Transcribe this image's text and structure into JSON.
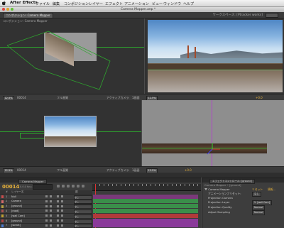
{
  "menubar": {
    "app_name": "After Effects",
    "items": [
      "ファイル",
      "編集",
      "コンポジション",
      "レイヤー",
      "エフェクト",
      "アニメーション",
      "ビュー",
      "ウィンドウ",
      "ヘルプ"
    ]
  },
  "window": {
    "title": "Camera Mapper.aep *"
  },
  "toolbar": {
    "panel_tab": "コンポジション: Camera Mapper",
    "workspace": "ワークスペース: [Ptracker works]"
  },
  "viewers": {
    "zoom": "12.5%",
    "timecode": "00014",
    "quality": "フル画質",
    "view_mode": "1画面",
    "camera": "アクティブカメラ",
    "exposure": "+0.0"
  },
  "timeline": {
    "tabs": [
      "Camera Mapper"
    ],
    "timecode": "00014",
    "fps": "0.0.0 fps (23.976)",
    "header": {
      "num": "#",
      "layer_name": "レイヤー名",
      "parent": "親"
    },
    "layers": [
      {
        "num": "1",
        "name": "Null",
        "color": "#c84b4b",
        "parent": "なし",
        "bar_color": "#7a3a7a"
      },
      {
        "num": "2",
        "name": "Camera",
        "color": "#d46a6a",
        "parent": "なし",
        "bar_color": "#3a8e4a"
      },
      {
        "num": "3",
        "name": "[ground]",
        "color": "#b8a040",
        "parent": "なし",
        "bar_color": "#3a8e4a"
      },
      {
        "num": "4",
        "name": "[road]",
        "color": "#a85050",
        "parent": "なし",
        "bar_color": "#3a8e4a"
      },
      {
        "num": "5",
        "name": "[wall Cam]",
        "color": "#c0a030",
        "parent": "なし",
        "bar_color": "#b03a3a"
      },
      {
        "num": "6",
        "name": "[ground]",
        "color": "#b04040",
        "parent": "なし",
        "bar_color": "#8a3a9a"
      },
      {
        "num": "7",
        "name": "[street]",
        "color": "#4a7ad0",
        "parent": "なし",
        "bar_color": "#8a3a9a"
      }
    ]
  },
  "effects": {
    "tabs": [
      "エフェクトコントロール: [ground]"
    ],
    "header": "Camera Mapper • [ground]",
    "rows": [
      {
        "label": "Camera Mapper",
        "value": "リセット",
        "extra": "情報..."
      },
      {
        "label": "アニメーションプリセット:",
        "value": "なし"
      },
      {
        "label": "Projection Camera",
        "value": ""
      },
      {
        "label": "Projection Layer",
        "value": "5. [wall Cam]"
      },
      {
        "label": "Projection Quality",
        "value": "Normal"
      },
      {
        "label": "Adjust Sampling",
        "value": "Normal"
      }
    ]
  },
  "colors": {
    "accent": "#e5b03a",
    "guide": "#2ea52e",
    "cti": "#dd3333",
    "panel_bg": "#323232"
  }
}
